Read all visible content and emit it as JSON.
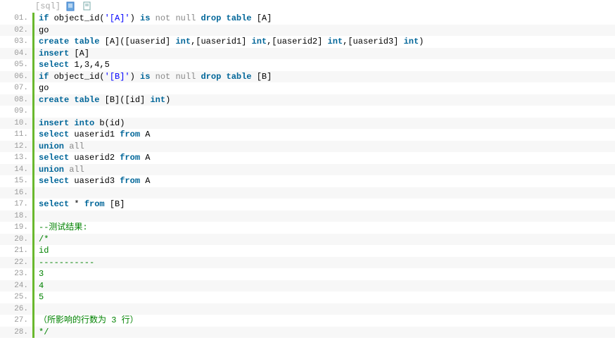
{
  "header": {
    "label": "[sql]"
  },
  "lines": [
    {
      "n": "01.",
      "segs": [
        {
          "t": "if",
          "c": "kw"
        },
        {
          "t": " object_id("
        },
        {
          "t": "'[A]'",
          "c": "str"
        },
        {
          "t": ") "
        },
        {
          "t": "is",
          "c": "kw"
        },
        {
          "t": " "
        },
        {
          "t": "not",
          "c": "grey"
        },
        {
          "t": " "
        },
        {
          "t": "null",
          "c": "grey"
        },
        {
          "t": " "
        },
        {
          "t": "drop",
          "c": "kw"
        },
        {
          "t": " "
        },
        {
          "t": "table",
          "c": "kw"
        },
        {
          "t": " [A]"
        }
      ]
    },
    {
      "n": "02.",
      "segs": [
        {
          "t": "go"
        }
      ]
    },
    {
      "n": "03.",
      "segs": [
        {
          "t": "create",
          "c": "kw"
        },
        {
          "t": " "
        },
        {
          "t": "table",
          "c": "kw"
        },
        {
          "t": " [A]([uaserid] "
        },
        {
          "t": "int",
          "c": "ty"
        },
        {
          "t": ",[uaserid1] "
        },
        {
          "t": "int",
          "c": "ty"
        },
        {
          "t": ",[uaserid2] "
        },
        {
          "t": "int",
          "c": "ty"
        },
        {
          "t": ",[uaserid3] "
        },
        {
          "t": "int",
          "c": "ty"
        },
        {
          "t": ")"
        }
      ]
    },
    {
      "n": "04.",
      "segs": [
        {
          "t": "insert",
          "c": "kw"
        },
        {
          "t": " [A]"
        }
      ]
    },
    {
      "n": "05.",
      "segs": [
        {
          "t": "select",
          "c": "kw"
        },
        {
          "t": " 1,3,4,5"
        }
      ]
    },
    {
      "n": "06.",
      "segs": [
        {
          "t": "if",
          "c": "kw"
        },
        {
          "t": " object_id("
        },
        {
          "t": "'[B]'",
          "c": "str"
        },
        {
          "t": ") "
        },
        {
          "t": "is",
          "c": "kw"
        },
        {
          "t": " "
        },
        {
          "t": "not",
          "c": "grey"
        },
        {
          "t": " "
        },
        {
          "t": "null",
          "c": "grey"
        },
        {
          "t": " "
        },
        {
          "t": "drop",
          "c": "kw"
        },
        {
          "t": " "
        },
        {
          "t": "table",
          "c": "kw"
        },
        {
          "t": " [B]"
        }
      ]
    },
    {
      "n": "07.",
      "segs": [
        {
          "t": "go"
        }
      ]
    },
    {
      "n": "08.",
      "segs": [
        {
          "t": "create",
          "c": "kw"
        },
        {
          "t": " "
        },
        {
          "t": "table",
          "c": "kw"
        },
        {
          "t": " [B]([id] "
        },
        {
          "t": "int",
          "c": "ty"
        },
        {
          "t": ")"
        }
      ]
    },
    {
      "n": "09.",
      "segs": []
    },
    {
      "n": "10.",
      "segs": [
        {
          "t": "insert",
          "c": "kw"
        },
        {
          "t": " "
        },
        {
          "t": "into",
          "c": "kw"
        },
        {
          "t": " b(id)"
        }
      ]
    },
    {
      "n": "11.",
      "segs": [
        {
          "t": "select",
          "c": "kw"
        },
        {
          "t": " uaserid1 "
        },
        {
          "t": "from",
          "c": "kw"
        },
        {
          "t": " A"
        }
      ]
    },
    {
      "n": "12.",
      "segs": [
        {
          "t": "union",
          "c": "kw"
        },
        {
          "t": " "
        },
        {
          "t": "all",
          "c": "grey"
        }
      ]
    },
    {
      "n": "13.",
      "segs": [
        {
          "t": "select",
          "c": "kw"
        },
        {
          "t": " uaserid2 "
        },
        {
          "t": "from",
          "c": "kw"
        },
        {
          "t": " A"
        }
      ]
    },
    {
      "n": "14.",
      "segs": [
        {
          "t": "union",
          "c": "kw"
        },
        {
          "t": " "
        },
        {
          "t": "all",
          "c": "grey"
        }
      ]
    },
    {
      "n": "15.",
      "segs": [
        {
          "t": "select",
          "c": "kw"
        },
        {
          "t": " uaserid3 "
        },
        {
          "t": "from",
          "c": "kw"
        },
        {
          "t": " A"
        }
      ]
    },
    {
      "n": "16.",
      "segs": []
    },
    {
      "n": "17.",
      "segs": [
        {
          "t": "select",
          "c": "kw"
        },
        {
          "t": " * "
        },
        {
          "t": "from",
          "c": "kw"
        },
        {
          "t": " [B]"
        }
      ]
    },
    {
      "n": "18.",
      "segs": []
    },
    {
      "n": "19.",
      "segs": [
        {
          "t": "--测试结果:",
          "c": "cmt"
        }
      ]
    },
    {
      "n": "20.",
      "segs": [
        {
          "t": "/*",
          "c": "cmt"
        }
      ]
    },
    {
      "n": "21.",
      "segs": [
        {
          "t": "id",
          "c": "cmt"
        }
      ]
    },
    {
      "n": "22.",
      "segs": [
        {
          "t": "-----------",
          "c": "cmt"
        }
      ]
    },
    {
      "n": "23.",
      "segs": [
        {
          "t": "3",
          "c": "cmt"
        }
      ]
    },
    {
      "n": "24.",
      "segs": [
        {
          "t": "4",
          "c": "cmt"
        }
      ]
    },
    {
      "n": "25.",
      "segs": [
        {
          "t": "5",
          "c": "cmt"
        }
      ]
    },
    {
      "n": "26.",
      "segs": []
    },
    {
      "n": "27.",
      "segs": [
        {
          "t": "（所影响的行数为 3 行）",
          "c": "cmt"
        }
      ]
    },
    {
      "n": "28.",
      "segs": [
        {
          "t": "*/",
          "c": "cmt"
        }
      ]
    }
  ]
}
